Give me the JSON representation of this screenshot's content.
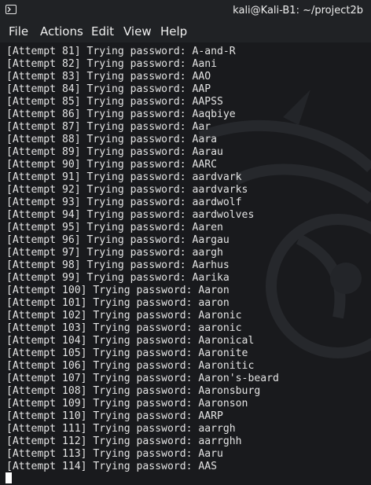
{
  "window": {
    "title": "kali@Kali-B1: ~/project2b",
    "icon": "terminal-icon"
  },
  "menu": {
    "file": "File",
    "actions": "Actions",
    "edit": "Edit",
    "view": "View",
    "help": "Help"
  },
  "terminal": {
    "lines": [
      "[Attempt 81] Trying password: A-and-R",
      "[Attempt 82] Trying password: Aani",
      "[Attempt 83] Trying password: AAO",
      "[Attempt 84] Trying password: AAP",
      "[Attempt 85] Trying password: AAPSS",
      "[Attempt 86] Trying password: Aaqbiye",
      "[Attempt 87] Trying password: Aar",
      "[Attempt 88] Trying password: Aara",
      "[Attempt 89] Trying password: Aarau",
      "[Attempt 90] Trying password: AARC",
      "[Attempt 91] Trying password: aardvark",
      "[Attempt 92] Trying password: aardvarks",
      "[Attempt 93] Trying password: aardwolf",
      "[Attempt 94] Trying password: aardwolves",
      "[Attempt 95] Trying password: Aaren",
      "[Attempt 96] Trying password: Aargau",
      "[Attempt 97] Trying password: aargh",
      "[Attempt 98] Trying password: Aarhus",
      "[Attempt 99] Trying password: Aarika",
      "[Attempt 100] Trying password: Aaron",
      "[Attempt 101] Trying password: aaron",
      "[Attempt 102] Trying password: Aaronic",
      "[Attempt 103] Trying password: aaronic",
      "[Attempt 104] Trying password: Aaronical",
      "[Attempt 105] Trying password: Aaronite",
      "[Attempt 106] Trying password: Aaronitic",
      "[Attempt 107] Trying password: Aaron's-beard",
      "[Attempt 108] Trying password: Aaronsburg",
      "[Attempt 109] Trying password: Aaronson",
      "[Attempt 110] Trying password: AARP",
      "[Attempt 111] Trying password: aarrgh",
      "[Attempt 112] Trying password: aarrghh",
      "[Attempt 113] Trying password: Aaru",
      "[Attempt 114] Trying password: AAS"
    ]
  },
  "colors": {
    "background": "#191a1d",
    "text": "#e3e3e3",
    "titlebar": "#202225"
  }
}
